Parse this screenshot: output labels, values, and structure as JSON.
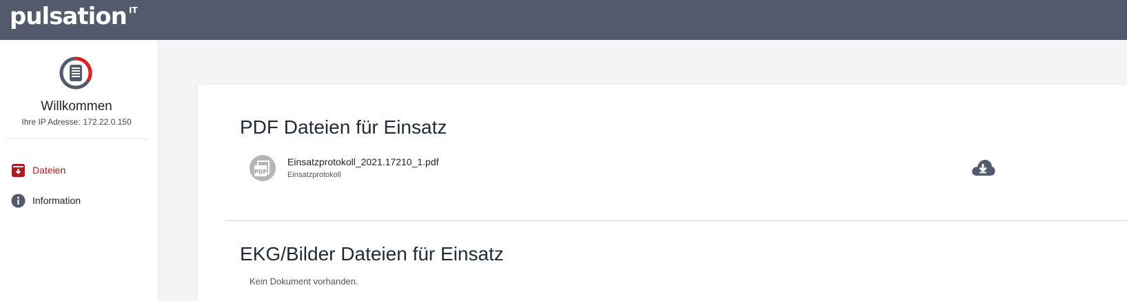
{
  "header": {
    "brand": "pulsation",
    "brand_sup": "IT"
  },
  "sidebar": {
    "app_icon": "document-ring-icon",
    "welcome": "Willkommen",
    "ip_label": "Ihre IP Adresse:",
    "ip_value": "172.22.0.150",
    "items": [
      {
        "label": "Dateien",
        "icon": "download-box-icon",
        "active": true,
        "color": "#b0191e"
      },
      {
        "label": "Information",
        "icon": "info-circle-icon",
        "active": false,
        "color": "#535a6c"
      }
    ]
  },
  "main": {
    "pdf_section": {
      "title": "PDF Dateien für Einsatz",
      "files": [
        {
          "name": "Einsatzprotokoll_2021.17210_1.pdf",
          "type": "Einsatzprotokoll",
          "icon": "pdf-file-icon",
          "action_icon": "cloud-download-icon"
        }
      ]
    },
    "ekg_section": {
      "title": "EKG/Bilder Dateien für Einsatz",
      "empty_message": "Kein Dokument vorhanden."
    }
  },
  "colors": {
    "topbar": "#535a6c",
    "accent_red": "#b0191e",
    "icon_dark": "#535a6c",
    "background": "#f3f4f5"
  }
}
